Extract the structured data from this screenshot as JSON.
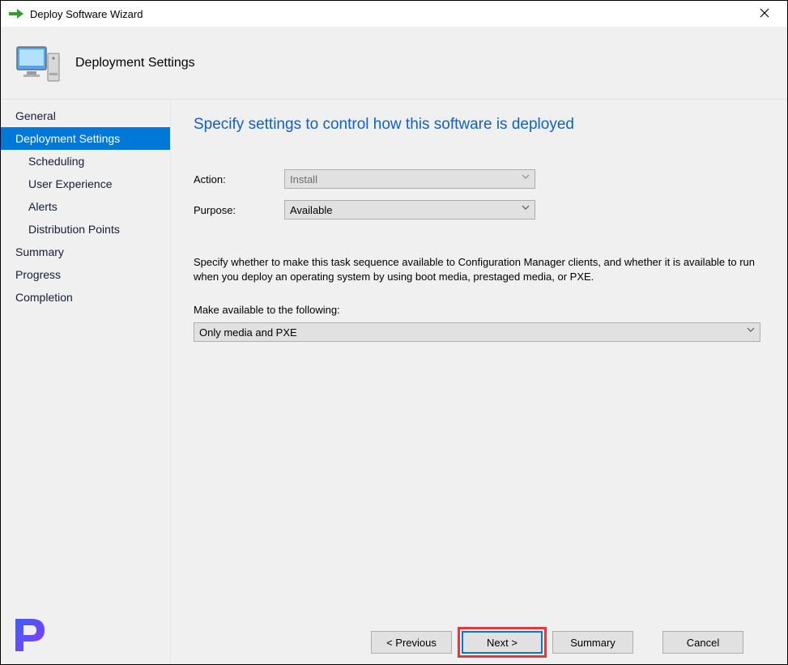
{
  "window": {
    "title": "Deploy Software Wizard"
  },
  "header": {
    "page_name": "Deployment Settings"
  },
  "sidebar": {
    "items": [
      {
        "label": "General",
        "sub": false,
        "selected": false
      },
      {
        "label": "Deployment Settings",
        "sub": false,
        "selected": true
      },
      {
        "label": "Scheduling",
        "sub": true,
        "selected": false
      },
      {
        "label": "User Experience",
        "sub": true,
        "selected": false
      },
      {
        "label": "Alerts",
        "sub": true,
        "selected": false
      },
      {
        "label": "Distribution Points",
        "sub": true,
        "selected": false
      },
      {
        "label": "Summary",
        "sub": false,
        "selected": false
      },
      {
        "label": "Progress",
        "sub": false,
        "selected": false
      },
      {
        "label": "Completion",
        "sub": false,
        "selected": false
      }
    ]
  },
  "main": {
    "heading": "Specify settings to control how this software is deployed",
    "action_label": "Action:",
    "action_value": "Install",
    "purpose_label": "Purpose:",
    "purpose_value": "Available",
    "description": "Specify whether to make this task sequence available to Configuration Manager clients, and whether it is available to run when you deploy an operating system by using boot media, prestaged media, or PXE.",
    "available_label": "Make available to the following:",
    "available_value": "Only media and PXE"
  },
  "footer": {
    "previous": "< Previous",
    "next": "Next >",
    "summary": "Summary",
    "cancel": "Cancel"
  }
}
